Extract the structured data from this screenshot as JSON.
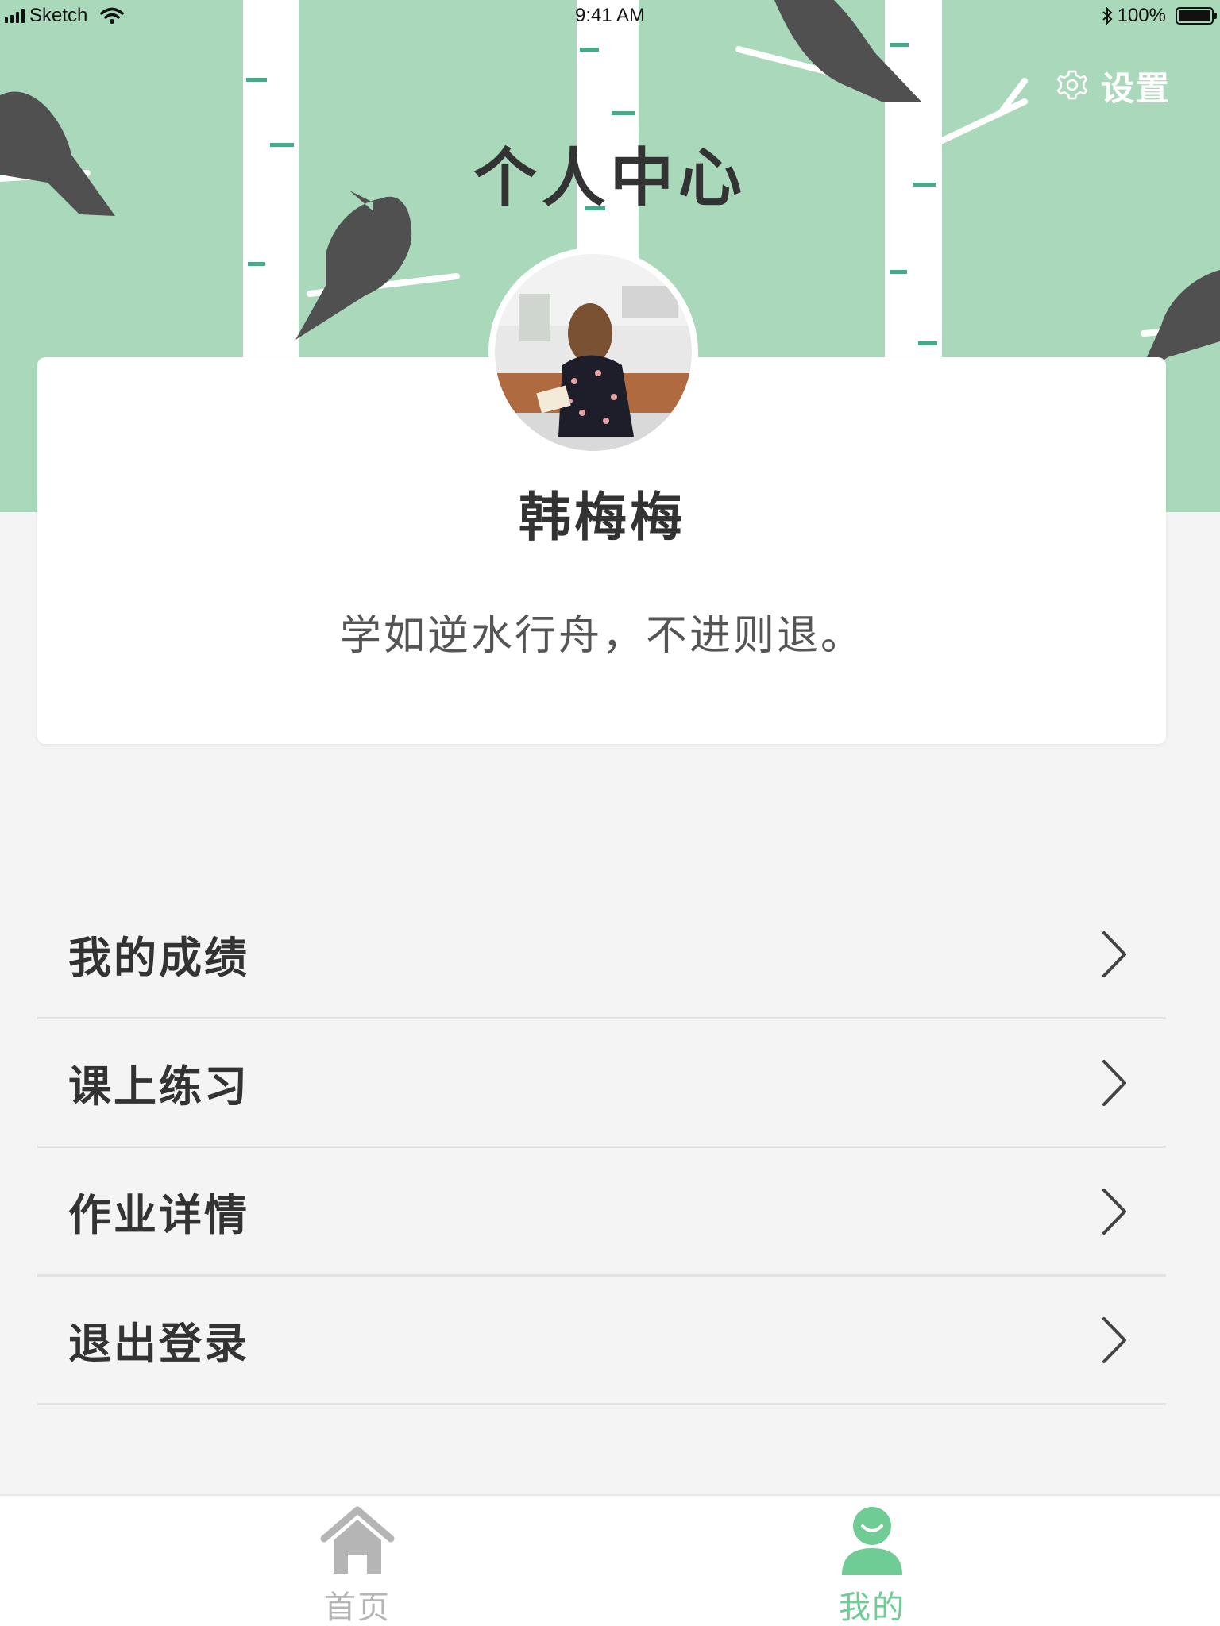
{
  "status_bar": {
    "carrier": "Sketch",
    "time": "9:41 AM",
    "battery": "100%",
    "battery_level": 1.0
  },
  "header": {
    "title": "个人中心",
    "settings_label": "设置",
    "background_color": "#a9d8ba"
  },
  "profile": {
    "name": "韩梅梅",
    "motto": "学如逆水行舟，不进则退。"
  },
  "menu": {
    "items": [
      {
        "label": "我的成绩",
        "icon": "chevron-right-icon"
      },
      {
        "label": "课上练习",
        "icon": "chevron-right-icon"
      },
      {
        "label": "作业详情",
        "icon": "chevron-right-icon"
      },
      {
        "label": "退出登录",
        "icon": "chevron-right-icon"
      }
    ]
  },
  "tab_bar": {
    "tabs": [
      {
        "label": "首页",
        "icon": "home-icon",
        "active": false
      },
      {
        "label": "我的",
        "icon": "user-icon",
        "active": true
      }
    ],
    "active_color": "#6fcc95",
    "inactive_color": "#b5b5b5"
  }
}
